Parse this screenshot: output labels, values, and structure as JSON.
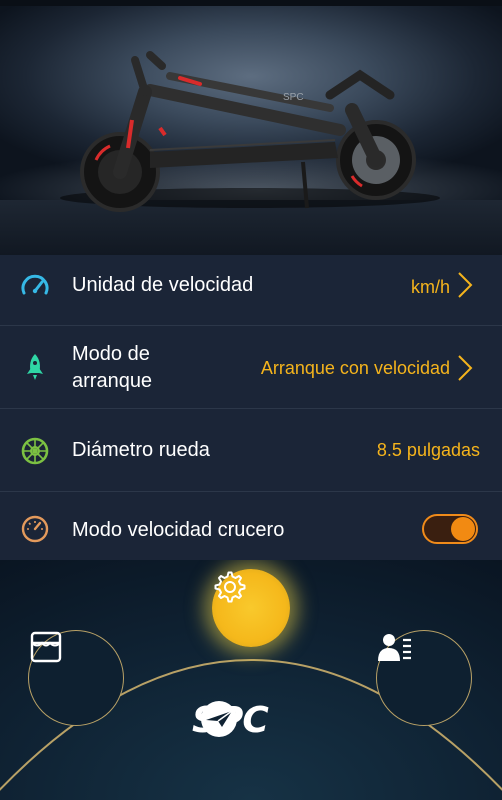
{
  "hero": {
    "alt": "scooter-photo",
    "frame_brand": "SPC"
  },
  "settings": [
    {
      "icon": "speedometer-icon",
      "label": "Unidad de velocidad",
      "value": "km/h",
      "has_chevron": true
    },
    {
      "icon": "rocket-icon",
      "label_line1": "Modo de",
      "label_line2": "arranque",
      "value": "Arranque con velocidad",
      "has_chevron": true
    },
    {
      "icon": "wheel-icon",
      "label": "Diámetro rueda",
      "value": "8.5 pulgadas",
      "has_chevron": false
    },
    {
      "icon": "cruise-gauge-icon",
      "label": "Modo velocidad crucero",
      "toggle": "on"
    }
  ],
  "nav": {
    "left": "store-icon",
    "center": "settings-gear-icon",
    "right": "user-list-icon",
    "brand": "SPC"
  },
  "colors": {
    "accent": "#f5b41c",
    "toggle": "#f28a12",
    "list_bg": "#1b2537",
    "icon_cyan": "#36b9e6",
    "icon_green": "#2fd6a5",
    "icon_lime": "#7cc142",
    "icon_orange": "#e39a5c"
  }
}
